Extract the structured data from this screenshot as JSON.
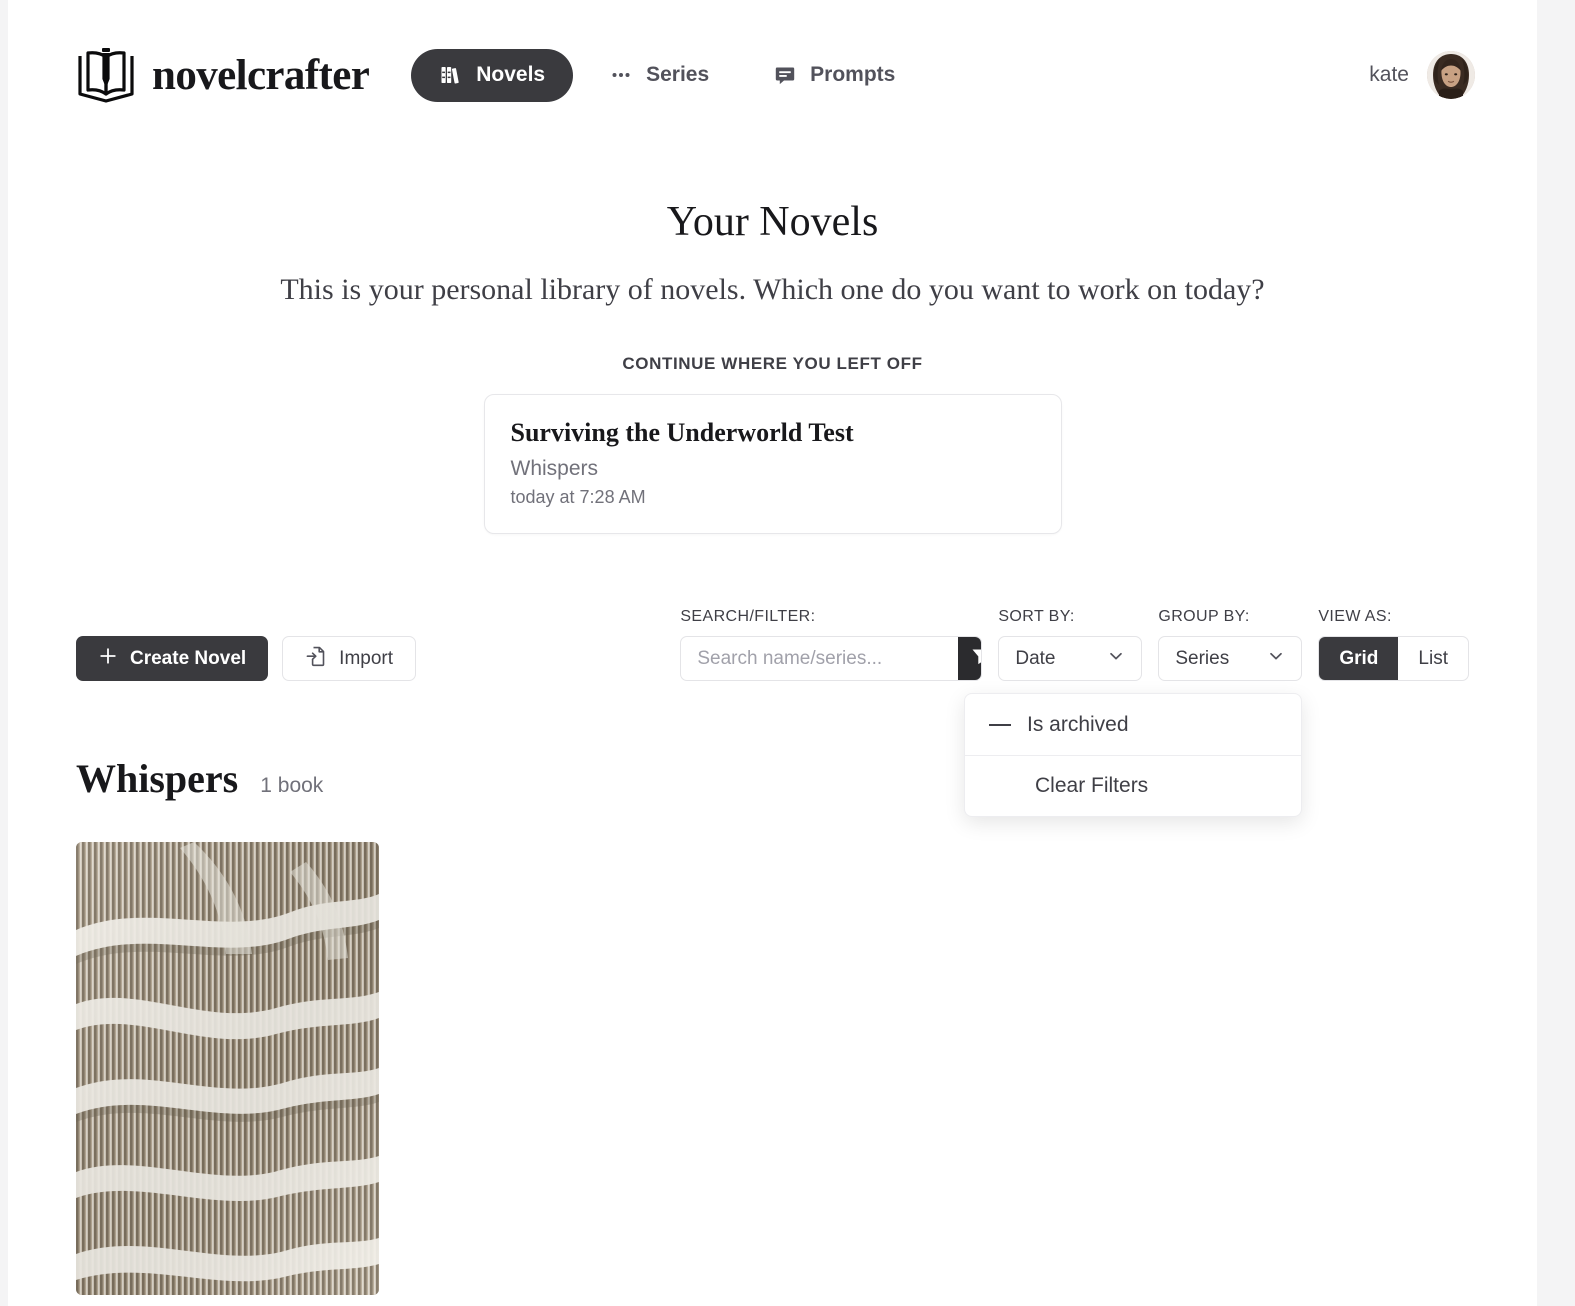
{
  "brand": {
    "name": "novelcrafter",
    "logo_icon": "book-pencil-logo"
  },
  "nav": {
    "items": [
      {
        "label": "Novels",
        "icon": "books-icon",
        "active": true
      },
      {
        "label": "Series",
        "icon": "dots-icon",
        "active": false
      },
      {
        "label": "Prompts",
        "icon": "chat-bubble-icon",
        "active": false
      }
    ]
  },
  "user": {
    "name": "kate",
    "avatar_icon": "user-avatar"
  },
  "hero": {
    "title": "Your Novels",
    "subtitle": "This is your personal library of novels. Which one do you want to work on today?"
  },
  "continue": {
    "label": "CONTINUE WHERE YOU LEFT OFF",
    "card": {
      "title": "Surviving the Underworld Test",
      "series": "Whispers",
      "time": "today at 7:28 AM"
    }
  },
  "toolbar": {
    "create_label": "Create Novel",
    "create_icon": "plus-icon",
    "import_label": "Import",
    "import_icon": "file-import-icon",
    "search_label": "SEARCH/FILTER:",
    "search_placeholder": "Search name/series...",
    "search_value": "",
    "filter_icon": "funnel-icon",
    "sort_label": "SORT BY:",
    "sort_value": "Date",
    "group_label": "GROUP BY:",
    "group_value": "Series",
    "view_label": "VIEW AS:",
    "view_options": [
      {
        "label": "Grid",
        "active": true
      },
      {
        "label": "List",
        "active": false
      }
    ]
  },
  "filter_menu": {
    "open": true,
    "items": [
      {
        "label": "Is archived",
        "indicator": "dash-icon"
      },
      {
        "label": "Clear Filters",
        "indicator": ""
      }
    ]
  },
  "series_groups": [
    {
      "name": "Whispers",
      "count": "1 book",
      "books": [
        {
          "cover_icon": "abstract-slats-cover"
        }
      ]
    }
  ],
  "colors": {
    "accent_dark": "#3a3a3e",
    "filter_button": "#2b2b2e",
    "text_primary": "#18181b",
    "text_secondary": "#71717a",
    "border": "#e4e4e7",
    "page_bg": "#ffffff",
    "outer_bg": "#f4f4f5"
  }
}
